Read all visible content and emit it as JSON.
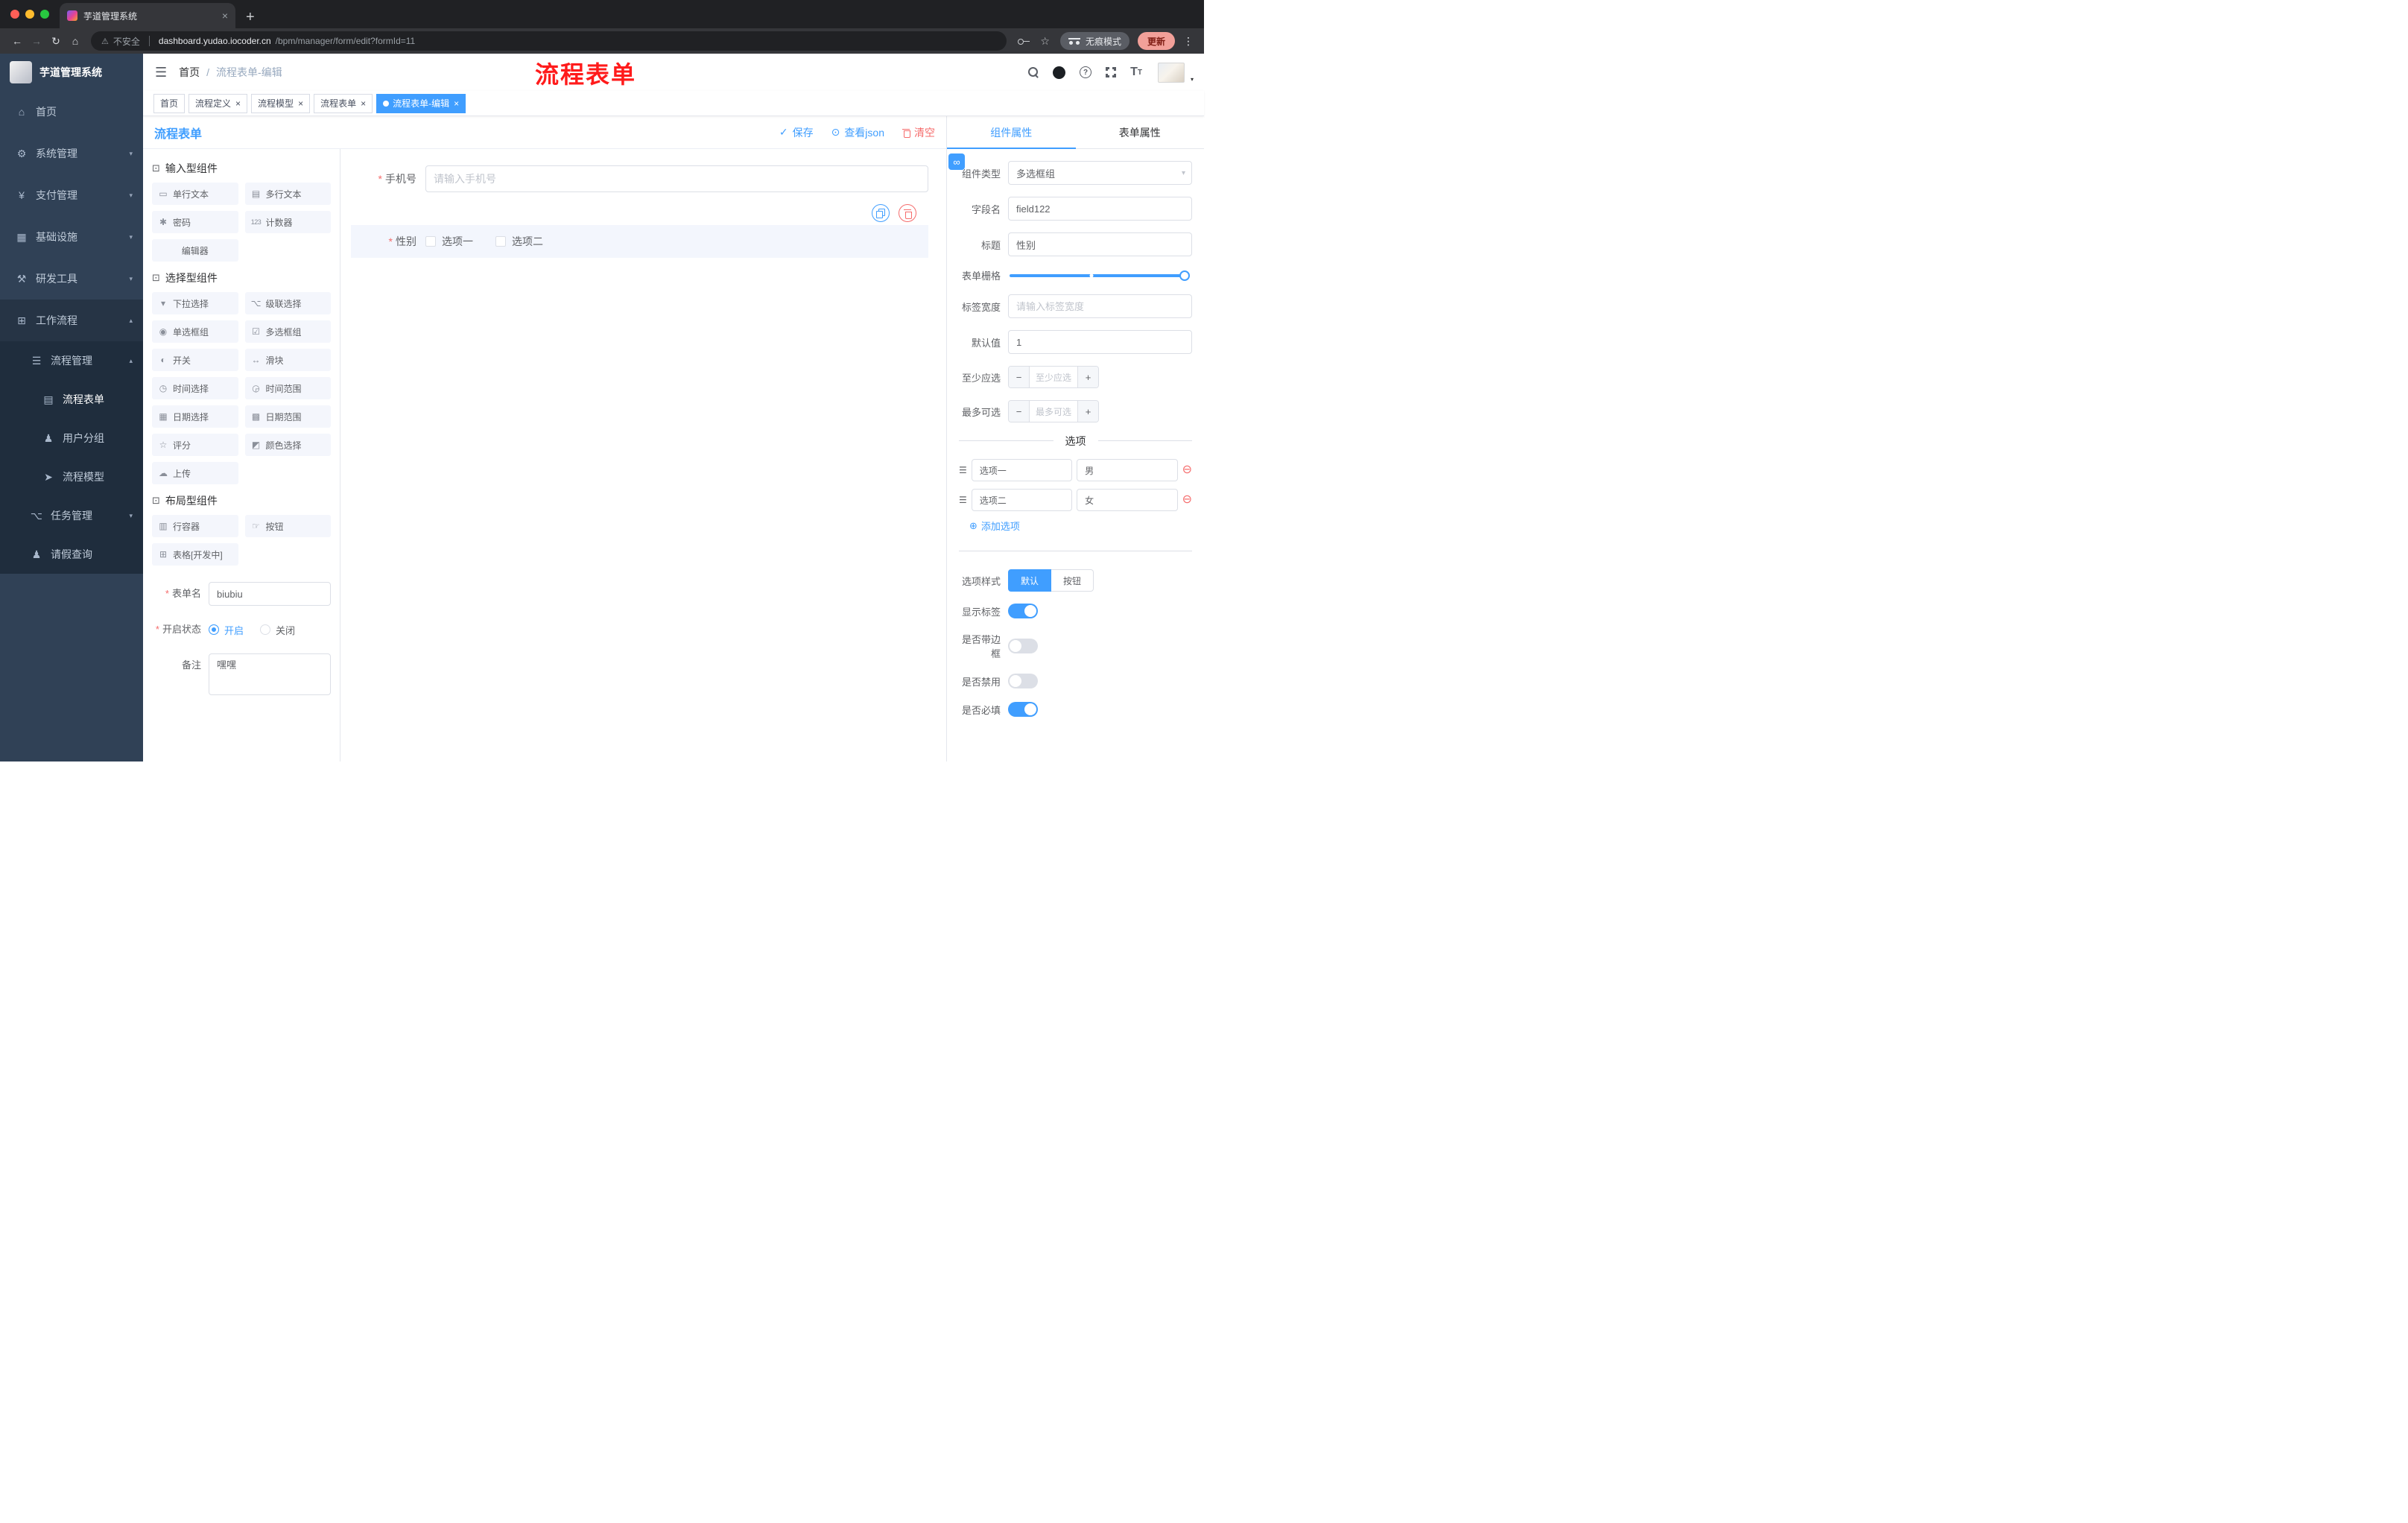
{
  "colors": {
    "accent": "#409EFF",
    "danger": "#F56C6C",
    "annotation": "#FF1B1B",
    "sidebar-bg": "#304156",
    "sidebar-open-bg": "#263445",
    "submenu-bg": "#1F2D3D",
    "chrome-dark": "#202124",
    "chrome-mid": "#35363A"
  },
  "icons": {
    "hamburger": "☰",
    "home": "⌂",
    "system": "⚙",
    "pay": "¥",
    "infra": "▦",
    "devtool": "⚒",
    "workflow": "⊞",
    "process_mgmt": "☰",
    "process_form": "▤",
    "user_group": "♟",
    "process_model": "➤",
    "task_mgmt": "⌥",
    "leave_query": "♟",
    "arrow_down": "▾",
    "arrow_up": "▴",
    "help": "?",
    "font_large": "T",
    "font_small": "T",
    "back": "←",
    "forward": "→",
    "reload": "↻",
    "browser_home": "⌂",
    "warning": "⚠",
    "star": "☆",
    "kebab": "⋮",
    "new_tab": "+",
    "close": "×",
    "check": "✓",
    "eye": "⊙",
    "select_arrow": "▾",
    "remove": "⊖",
    "add": "⊕",
    "drag": "☰",
    "link": "∞",
    "minus": "−",
    "plus": "+",
    "section": "⊡"
  },
  "browser": {
    "tab_title": "芋道管理系统",
    "security_label": "不安全",
    "url_domain": "dashboard.yudao.iocoder.cn",
    "url_path": "/bpm/manager/form/edit?formId=11",
    "incognito_label": "无痕模式",
    "update_label": "更新"
  },
  "sidebar": {
    "logo": "芋道管理系统",
    "menu": [
      "首页",
      "系统管理",
      "支付管理",
      "基础设施",
      "研发工具",
      "工作流程"
    ],
    "sub": {
      "process_mgmt": "流程管理",
      "children": [
        "流程表单",
        "用户分组",
        "流程模型"
      ],
      "task_mgmt": "任务管理",
      "leave_query": "请假查询"
    }
  },
  "header": {
    "breadcrumb": [
      "首页",
      "流程表单-编辑"
    ],
    "annotation": "流程表单"
  },
  "tags": [
    {
      "label": "首页"
    },
    {
      "label": "流程定义"
    },
    {
      "label": "流程模型"
    },
    {
      "label": "流程表单"
    },
    {
      "label": "流程表单-编辑"
    }
  ],
  "designer": {
    "title": "流程表单",
    "actions": {
      "save": "保存",
      "view_json": "查看json",
      "clear": "清空"
    },
    "sections": [
      {
        "title": "输入型组件",
        "items": [
          "单行文本",
          "多行文本",
          "密码",
          "计数器",
          "编辑器"
        ],
        "icons": [
          "▭",
          "▤",
          "✱",
          "123",
          ""
        ]
      },
      {
        "title": "选择型组件",
        "items": [
          "下拉选择",
          "级联选择",
          "单选框组",
          "多选框组",
          "开关",
          "滑块",
          "时间选择",
          "时间范围",
          "日期选择",
          "日期范围",
          "评分",
          "颜色选择",
          "上传"
        ],
        "icons": [
          "▾",
          "⌥",
          "◉",
          "☑",
          "◐",
          "↔",
          "◷",
          "◶",
          "▦",
          "▩",
          "☆",
          "◩",
          "☁"
        ]
      },
      {
        "title": "布局型组件",
        "items": [
          "行容器",
          "按钮",
          "表格[开发中]"
        ],
        "icons": [
          "▥",
          "☞",
          "⊞"
        ]
      }
    ],
    "meta": {
      "name_label": "表单名",
      "name_value": "biubiu",
      "status_label": "开启状态",
      "status_on": "开启",
      "status_off": "关闭",
      "remark_label": "备注",
      "remark_value": "嘿嘿"
    }
  },
  "canvas": {
    "phone": {
      "label": "手机号",
      "placeholder": "请输入手机号"
    },
    "gender": {
      "label": "性别",
      "options": [
        "选项一",
        "选项二"
      ]
    }
  },
  "props": {
    "tabs": [
      "组件属性",
      "表单属性"
    ],
    "component_type": {
      "label": "组件类型",
      "value": "多选框组"
    },
    "field_name": {
      "label": "字段名",
      "value": "field122"
    },
    "title": {
      "label": "标题",
      "value": "性别"
    },
    "grid": {
      "label": "表单栅格"
    },
    "label_width": {
      "label": "标签宽度",
      "placeholder": "请输入标签宽度"
    },
    "default_value": {
      "label": "默认值",
      "value": "1"
    },
    "min_select": {
      "label": "至少应选",
      "placeholder": "至少应选"
    },
    "max_select": {
      "label": "最多可选",
      "placeholder": "最多可选"
    },
    "options_title": "选项",
    "options": [
      {
        "label": "选项一",
        "value": "男"
      },
      {
        "label": "选项二",
        "value": "女"
      }
    ],
    "add_option": "添加选项",
    "option_style": {
      "label": "选项样式",
      "options": [
        "默认",
        "按钮"
      ]
    },
    "switches": [
      {
        "label": "显示标签",
        "on": true
      },
      {
        "label": "是否带边框",
        "on": false
      },
      {
        "label": "是否禁用",
        "on": false
      },
      {
        "label": "是否必填",
        "on": true
      }
    ]
  }
}
